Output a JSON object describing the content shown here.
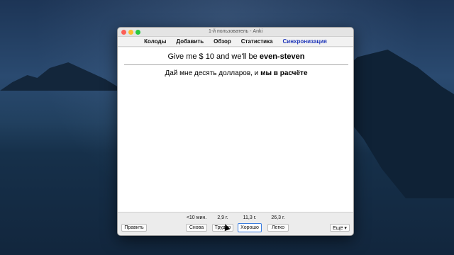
{
  "window": {
    "title": "1-й пользователь - Anki"
  },
  "menu": {
    "decks": "Колоды",
    "add": "Добавить",
    "browse": "Обзор",
    "stats": "Статистика",
    "sync": "Синхронизация"
  },
  "card": {
    "front_plain": "Give me $ 10 and we'll be ",
    "front_bold": "even-steven",
    "back_plain": "Дай мне десять долларов, и ",
    "back_bold": "мы в расчёте"
  },
  "answer_bar": {
    "edit_label": "Править",
    "more_label": "Ещё ▾",
    "buttons": [
      {
        "interval": "<10 мин.",
        "label": "Снова"
      },
      {
        "interval": "2,9 г.",
        "label": "Трудно"
      },
      {
        "interval": "11,3 г.",
        "label": "Хорошо"
      },
      {
        "interval": "26,3 г.",
        "label": "Легко"
      }
    ]
  }
}
